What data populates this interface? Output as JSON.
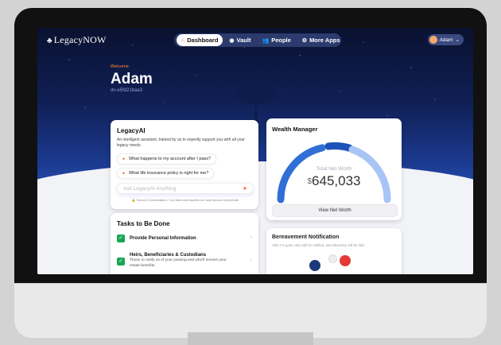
{
  "app": {
    "logo": "LegacyNOW"
  },
  "nav": [
    {
      "label": "Dashboard",
      "icon": "home-icon",
      "active": true
    },
    {
      "label": "Vault",
      "icon": "vault-icon",
      "active": false
    },
    {
      "label": "People",
      "icon": "people-icon",
      "active": false
    },
    {
      "label": "More Apps",
      "icon": "apps-icon",
      "active": false
    }
  ],
  "user": {
    "name": "Adam"
  },
  "hero": {
    "welcome": "Welcome",
    "name": "Adam",
    "uid": "dv-e5fd21baa3"
  },
  "ai": {
    "title": "LegacyAI",
    "description": "An intelligent assistant, trained by us to expertly support you with all your legacy needs.",
    "suggestions": [
      "What happens to my account after I pass?",
      "What life insurance policy is right for me?"
    ],
    "placeholder": "Ask LegacyAI Anything",
    "secure_note": "Secured Conversation • Your data and inquiries are kept secured and private"
  },
  "tasks": {
    "title": "Tasks to Be Done",
    "items": [
      {
        "title": "Provide Personal Information",
        "subtitle": ""
      },
      {
        "title": "Heirs, Beneficiaries & Custodians",
        "subtitle": "Those to notify us of your passing and who'll receive your estate benefits."
      }
    ]
  },
  "wealth": {
    "title": "Wealth Manager",
    "total_label": "Total Net Worth",
    "currency": "$",
    "amount": "645,033",
    "button": "View Net Worth"
  },
  "bereavement": {
    "title": "Bereavement Notification",
    "subtitle": "After I'm gone, who will be notified, and what they will be told."
  },
  "colors": {
    "accent": "#ff6b3d",
    "check": "#19a555",
    "gauge_blue": "#2f6fd6"
  }
}
